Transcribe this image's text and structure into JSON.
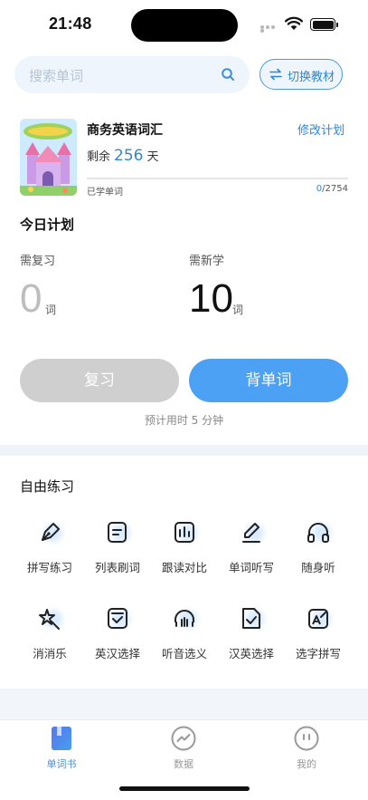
{
  "status_bar": {
    "time": "21:48"
  },
  "search": {
    "placeholder": "搜索单词"
  },
  "switch_book": {
    "label": "切换教材"
  },
  "book": {
    "title": "商务英语词汇",
    "edit_plan": "修改计划",
    "remain_prefix": "剩余",
    "remain_days": "256",
    "remain_suffix": "天",
    "learned_label": "已学单词",
    "learned": "0",
    "total": "/2754",
    "progress": 0.0
  },
  "today_plan": {
    "title": "今日计划",
    "review_label": "需复习",
    "review_count": "0",
    "new_label": "需新学",
    "new_count": "10",
    "unit": "词"
  },
  "buttons": {
    "review": "复习",
    "learn": "背单词"
  },
  "estimate": "预计用时 5 分钟",
  "free_practice": {
    "title": "自由练习",
    "items": [
      {
        "label": "拼写练习",
        "icon": "pen-nib-icon"
      },
      {
        "label": "列表刷词",
        "icon": "list-card-icon"
      },
      {
        "label": "跟读对比",
        "icon": "audio-bars-icon"
      },
      {
        "label": "单词听写",
        "icon": "pencil-icon"
      },
      {
        "label": "随身听",
        "icon": "headphones-icon"
      },
      {
        "label": "消消乐",
        "icon": "magic-wand-icon"
      },
      {
        "label": "英汉选择",
        "icon": "check-box-icon"
      },
      {
        "label": "听音选义",
        "icon": "listen-icon"
      },
      {
        "label": "汉英选择",
        "icon": "doc-check-icon"
      },
      {
        "label": "选字拼写",
        "icon": "image-edit-icon"
      }
    ]
  },
  "tabs": [
    {
      "label": "单词书",
      "icon": "book-icon"
    },
    {
      "label": "数据",
      "icon": "chart-icon"
    },
    {
      "label": "我的",
      "icon": "profile-icon"
    }
  ],
  "colors": {
    "accent": "#4da1f5",
    "link": "#2f86d6",
    "disabled": "#cfcfcf"
  }
}
